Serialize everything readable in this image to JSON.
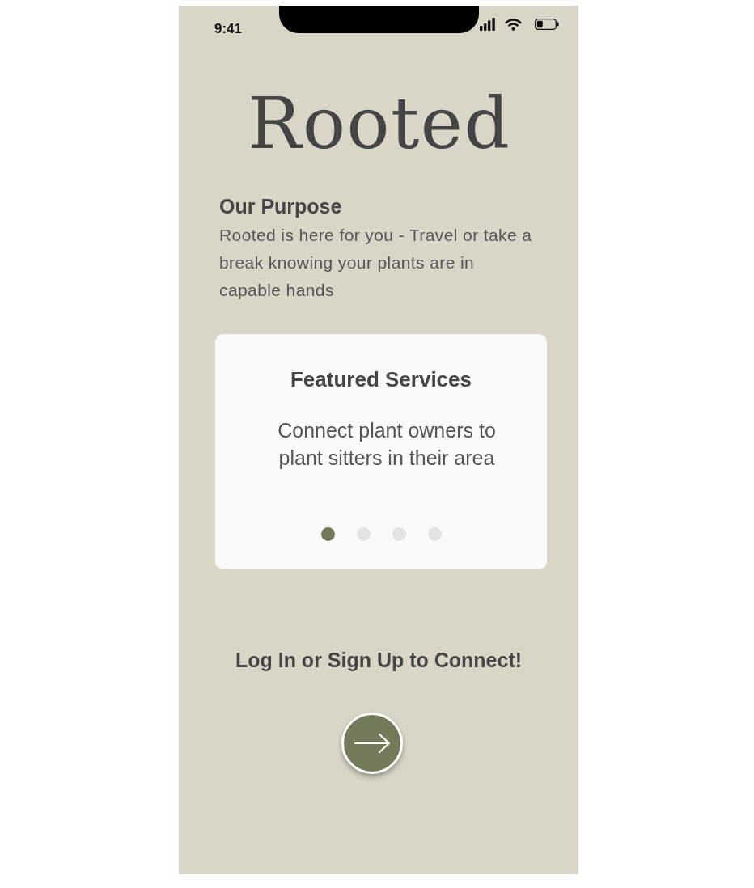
{
  "status_bar": {
    "time": "9:41"
  },
  "app": {
    "title": "Rooted"
  },
  "purpose": {
    "heading": "Our Purpose",
    "body": "Rooted is here for you - Travel or take a break knowing your plants are in capable hands"
  },
  "featured_card": {
    "title": "Featured Services",
    "description": "Connect plant owners to plant sitters in their area",
    "pages": [
      {
        "selected": true
      },
      {
        "selected": false
      },
      {
        "selected": false
      },
      {
        "selected": false
      }
    ]
  },
  "call_to_action": {
    "text": "Log In or Sign Up to Connect!"
  }
}
